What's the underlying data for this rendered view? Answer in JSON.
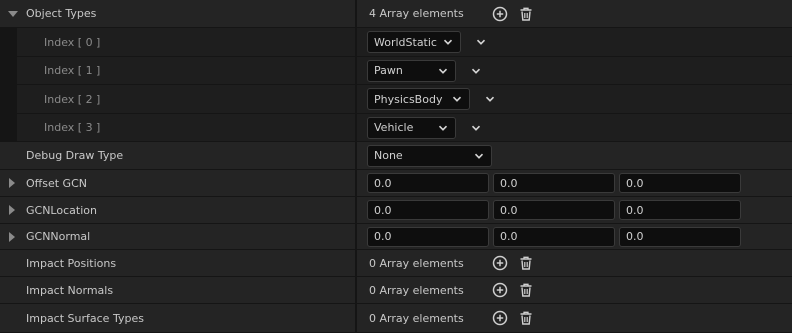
{
  "rows": {
    "object_types": {
      "label": "Object Types",
      "value": "4 Array elements"
    },
    "index0": {
      "label": "Index [ 0 ]",
      "value": "WorldStatic"
    },
    "index1": {
      "label": "Index [ 1 ]",
      "value": "Pawn"
    },
    "index2": {
      "label": "Index [ 2 ]",
      "value": "PhysicsBody"
    },
    "index3": {
      "label": "Index [ 3 ]",
      "value": "Vehicle"
    },
    "debug_draw_type": {
      "label": "Debug Draw Type",
      "value": "None"
    },
    "offset_gcn": {
      "label": "Offset GCN",
      "x": "0.0",
      "y": "0.0",
      "z": "0.0"
    },
    "gcn_location": {
      "label": "GCNLocation",
      "x": "0.0",
      "y": "0.0",
      "z": "0.0"
    },
    "gcn_normal": {
      "label": "GCNNormal",
      "x": "0.0",
      "y": "0.0",
      "z": "0.0"
    },
    "impact_positions": {
      "label": "Impact Positions",
      "value": "0 Array elements"
    },
    "impact_normals": {
      "label": "Impact Normals",
      "value": "0 Array elements"
    },
    "impact_surface_types": {
      "label": "Impact Surface Types",
      "value": "0 Array elements"
    }
  },
  "icons": {
    "add": "plus-circle-icon",
    "delete": "trash-icon",
    "dropdown": "chevron-down-icon",
    "expand": "triangle-right-icon",
    "collapse": "triangle-down-icon"
  }
}
